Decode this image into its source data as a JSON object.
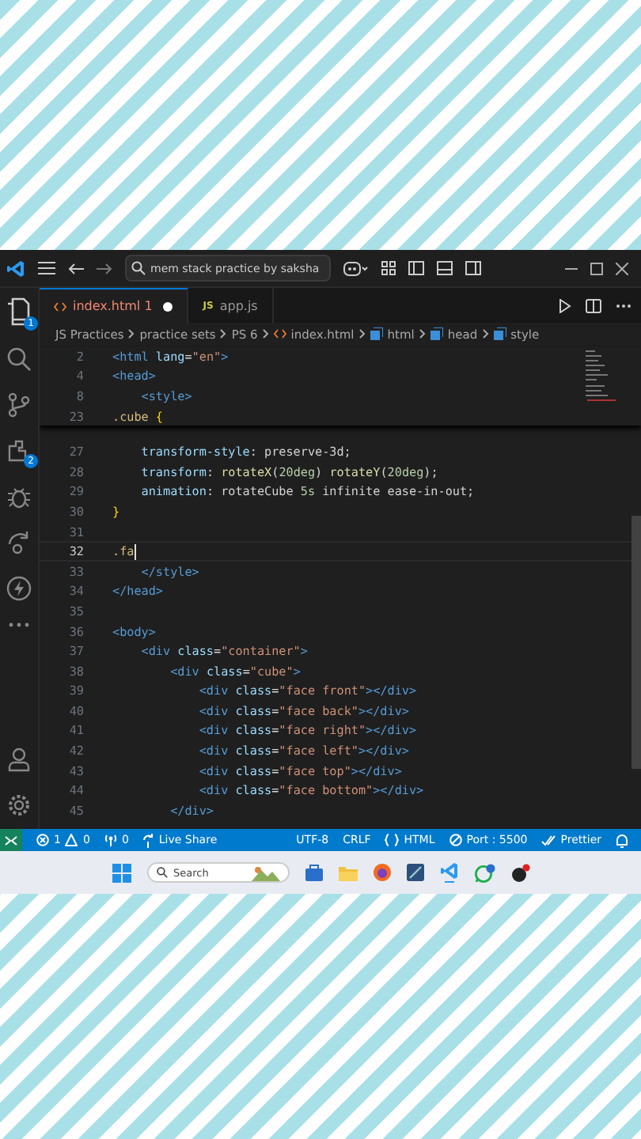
{
  "title_bar": {
    "search": "mem stack practice by saksha"
  },
  "tabs": [
    {
      "kind": "html",
      "label": "index.html",
      "problems": "1",
      "dirty": true,
      "selected": true
    },
    {
      "kind": "js",
      "icon_text": "JS",
      "label": "app.js",
      "dirty": false,
      "selected": false
    }
  ],
  "activity_bar": {
    "explorer_badge": "1",
    "extensions_badge": "2"
  },
  "breadcrumb": [
    {
      "kind": "folder",
      "text": "JS Practices"
    },
    {
      "kind": "folder",
      "text": "practice sets"
    },
    {
      "kind": "folder",
      "text": "PS 6"
    },
    {
      "kind": "html",
      "text": "index.html"
    },
    {
      "kind": "element",
      "text": "html"
    },
    {
      "kind": "element",
      "text": "head"
    },
    {
      "kind": "element",
      "text": "style"
    }
  ],
  "sticky_lines": [
    {
      "number": "2",
      "tokens": [
        {
          "kind": "tag",
          "text": "<html"
        },
        {
          "kind": "attr",
          "text": " lang"
        },
        {
          "kind": "plain",
          "text": "="
        },
        {
          "kind": "string",
          "text": "\"en\""
        },
        {
          "kind": "tag",
          "text": ">"
        }
      ]
    },
    {
      "number": "4",
      "tokens": [
        {
          "kind": "tag",
          "text": "<head>"
        }
      ]
    },
    {
      "number": "8",
      "tokens": [
        {
          "kind": "tag",
          "text": "    <style>"
        }
      ]
    },
    {
      "number": "23",
      "tokens": [
        {
          "kind": "selector",
          "text": ".cube"
        },
        {
          "kind": "brace",
          "text": " {"
        }
      ]
    }
  ],
  "lines": [
    {
      "number": "27",
      "current": false,
      "tokens": [
        {
          "kind": "prop",
          "text": "    transform-style"
        },
        {
          "kind": "plain",
          "text": ": preserve-3d;"
        }
      ]
    },
    {
      "number": "28",
      "current": false,
      "tokens": [
        {
          "kind": "prop",
          "text": "    transform"
        },
        {
          "kind": "plain",
          "text": ": "
        },
        {
          "kind": "func",
          "text": "rotateX"
        },
        {
          "kind": "plain",
          "text": "("
        },
        {
          "kind": "number",
          "text": "20deg"
        },
        {
          "kind": "plain",
          "text": ") "
        },
        {
          "kind": "func",
          "text": "rotateY"
        },
        {
          "kind": "plain",
          "text": "("
        },
        {
          "kind": "number",
          "text": "20deg"
        },
        {
          "kind": "plain",
          "text": ");"
        }
      ]
    },
    {
      "number": "29",
      "current": false,
      "tokens": [
        {
          "kind": "prop",
          "text": "    animation"
        },
        {
          "kind": "plain",
          "text": ": rotateCube "
        },
        {
          "kind": "number",
          "text": "5s"
        },
        {
          "kind": "plain",
          "text": " infinite ease-in-out;"
        }
      ]
    },
    {
      "number": "30",
      "current": false,
      "tokens": [
        {
          "kind": "brace",
          "text": "}"
        }
      ]
    },
    {
      "number": "31",
      "current": false
    },
    {
      "number": "32",
      "current": true,
      "tokens": [
        {
          "kind": "selector",
          "text": ".fa"
        }
      ]
    },
    {
      "number": "33",
      "current": false,
      "tokens": [
        {
          "kind": "tag",
          "text": "    </style>"
        }
      ]
    },
    {
      "number": "34",
      "current": false,
      "tokens": [
        {
          "kind": "tag",
          "text": "</head>"
        }
      ]
    },
    {
      "number": "35",
      "current": false
    },
    {
      "number": "36",
      "current": false,
      "tokens": [
        {
          "kind": "tag",
          "text": "<body>"
        }
      ]
    },
    {
      "number": "37",
      "current": false,
      "tokens": [
        {
          "kind": "tag",
          "text": "    <div"
        },
        {
          "kind": "attr",
          "text": " class"
        },
        {
          "kind": "plain",
          "text": "="
        },
        {
          "kind": "string",
          "text": "\"container\""
        },
        {
          "kind": "tag",
          "text": ">"
        }
      ]
    },
    {
      "number": "38",
      "current": false,
      "tokens": [
        {
          "kind": "tag",
          "text": "        <div"
        },
        {
          "kind": "attr",
          "text": " class"
        },
        {
          "kind": "plain",
          "text": "="
        },
        {
          "kind": "string",
          "text": "\"cube\""
        },
        {
          "kind": "tag",
          "text": ">"
        }
      ]
    },
    {
      "number": "39",
      "current": false,
      "tokens": [
        {
          "kind": "tag",
          "text": "            <div"
        },
        {
          "kind": "attr",
          "text": " class"
        },
        {
          "kind": "plain",
          "text": "="
        },
        {
          "kind": "string",
          "text": "\"face front\""
        },
        {
          "kind": "tag",
          "text": "></div>"
        }
      ]
    },
    {
      "number": "40",
      "current": false,
      "tokens": [
        {
          "kind": "tag",
          "text": "            <div"
        },
        {
          "kind": "attr",
          "text": " class"
        },
        {
          "kind": "plain",
          "text": "="
        },
        {
          "kind": "string",
          "text": "\"face back\""
        },
        {
          "kind": "tag",
          "text": "></div>"
        }
      ]
    },
    {
      "number": "41",
      "current": false,
      "tokens": [
        {
          "kind": "tag",
          "text": "            <div"
        },
        {
          "kind": "attr",
          "text": " class"
        },
        {
          "kind": "plain",
          "text": "="
        },
        {
          "kind": "string",
          "text": "\"face right\""
        },
        {
          "kind": "tag",
          "text": "></div>"
        }
      ]
    },
    {
      "number": "42",
      "current": false,
      "tokens": [
        {
          "kind": "tag",
          "text": "            <div"
        },
        {
          "kind": "attr",
          "text": " class"
        },
        {
          "kind": "plain",
          "text": "="
        },
        {
          "kind": "string",
          "text": "\"face left\""
        },
        {
          "kind": "tag",
          "text": "></div>"
        }
      ]
    },
    {
      "number": "43",
      "current": false,
      "tokens": [
        {
          "kind": "tag",
          "text": "            <div"
        },
        {
          "kind": "attr",
          "text": " class"
        },
        {
          "kind": "plain",
          "text": "="
        },
        {
          "kind": "string",
          "text": "\"face top\""
        },
        {
          "kind": "tag",
          "text": "></div>"
        }
      ]
    },
    {
      "number": "44",
      "current": false,
      "tokens": [
        {
          "kind": "tag",
          "text": "            <div"
        },
        {
          "kind": "attr",
          "text": " class"
        },
        {
          "kind": "plain",
          "text": "="
        },
        {
          "kind": "string",
          "text": "\"face bottom\""
        },
        {
          "kind": "tag",
          "text": "></div>"
        }
      ]
    },
    {
      "number": "45",
      "current": false,
      "tokens": [
        {
          "kind": "tag",
          "text": "        </div>"
        }
      ]
    }
  ],
  "status_bar": {
    "errors": "1",
    "warnings": "0",
    "ports": "0",
    "live_share": "Live Share",
    "encoding": "UTF-8",
    "eol": "CRLF",
    "language": "HTML",
    "port": "Port : 5500",
    "formatter": "Prettier"
  },
  "taskbar": {
    "search": "Search"
  }
}
